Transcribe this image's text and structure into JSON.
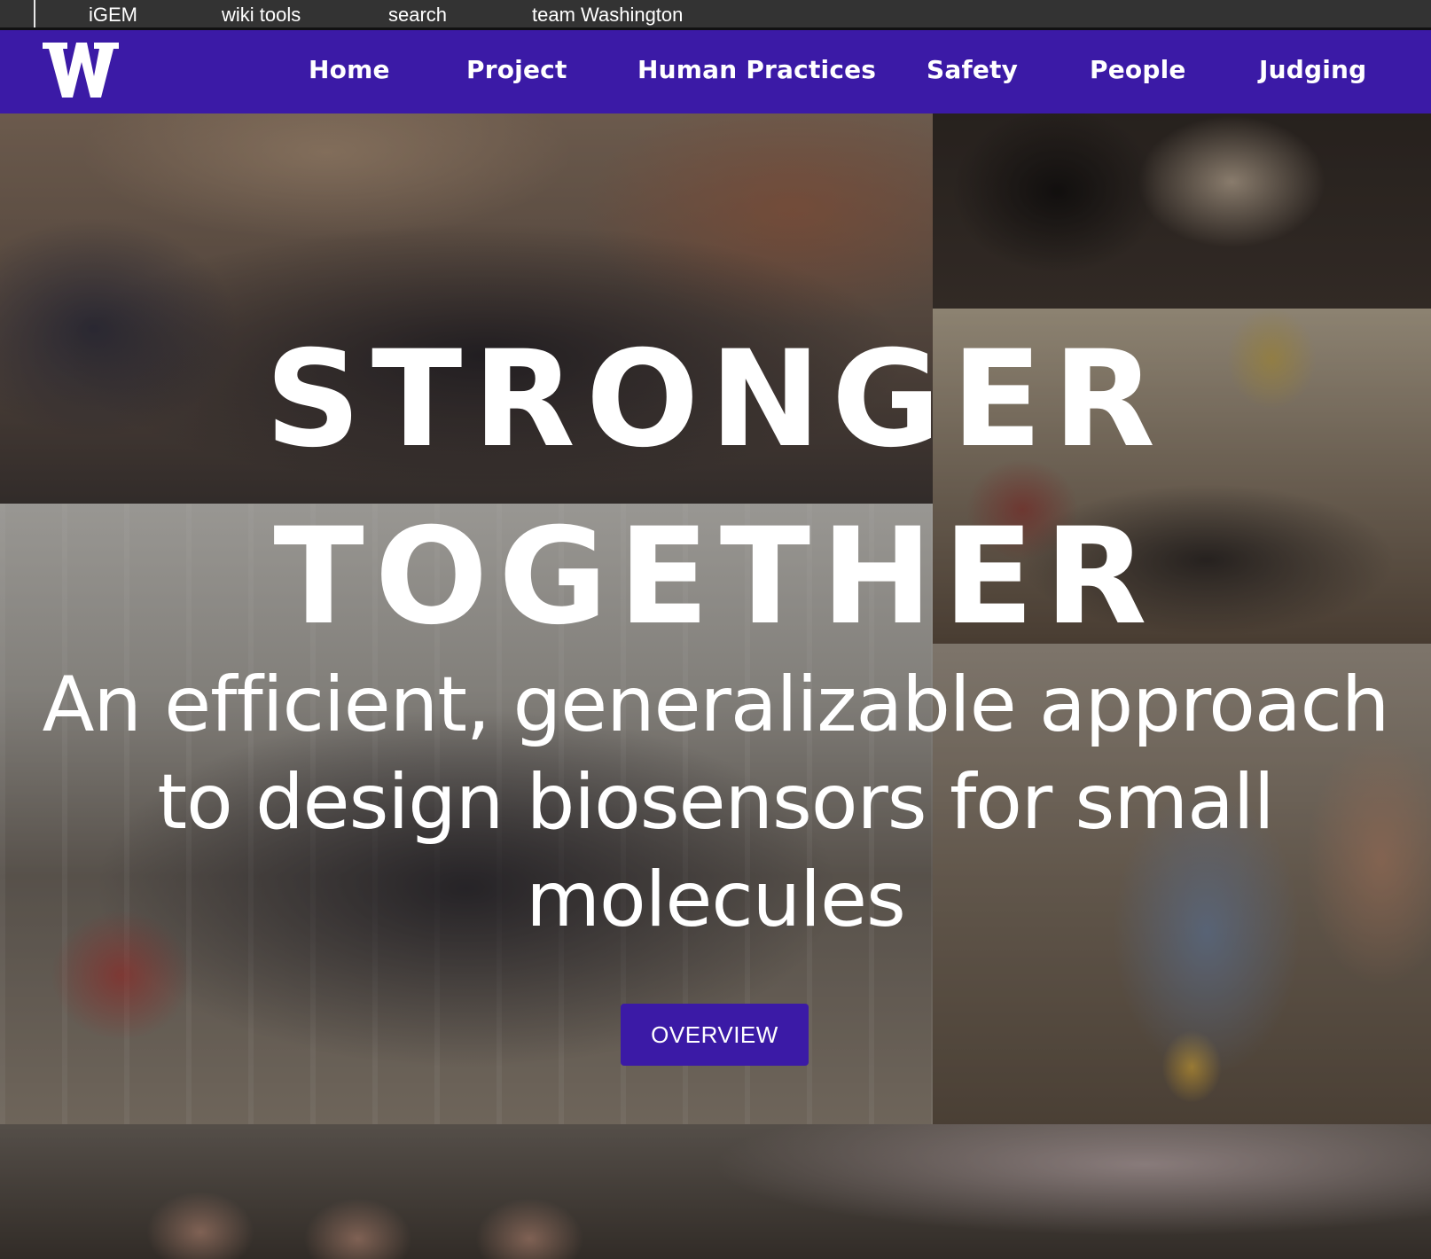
{
  "igem_bar": {
    "links": [
      "iGEM",
      "wiki tools",
      "search",
      "team Washington"
    ]
  },
  "site_nav": {
    "logo_icon": "uw-w-logo-icon",
    "items": [
      "Home",
      "Project",
      "Human Practices",
      "Safety",
      "People",
      "Judging"
    ]
  },
  "hero": {
    "title_line1": "STRONGER",
    "title_line2": "TOGETHER",
    "subtitle": "An efficient, generalizable approach to design biosensors for small molecules",
    "button_label": "OVERVIEW"
  },
  "colors": {
    "igem_bar": "#333333",
    "nav_background": "#3b1aa6",
    "button_background": "#3b1aa6",
    "text": "#ffffff"
  }
}
